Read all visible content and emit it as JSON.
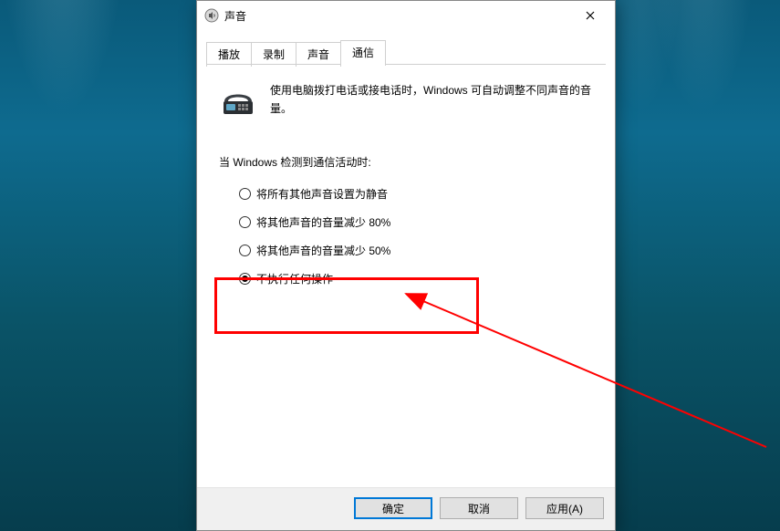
{
  "window": {
    "title": "声音"
  },
  "tabs": [
    {
      "label": "播放",
      "active": false
    },
    {
      "label": "录制",
      "active": false
    },
    {
      "label": "声音",
      "active": false
    },
    {
      "label": "通信",
      "active": true
    }
  ],
  "intro": "使用电脑拨打电话或接电话时，Windows 可自动调整不同声音的音量。",
  "subhead": "当 Windows 检测到通信活动时:",
  "options": [
    {
      "label": "将所有其他声音设置为静音",
      "checked": false
    },
    {
      "label": "将其他声音的音量减少 80%",
      "checked": false
    },
    {
      "label": "将其他声音的音量减少 50%",
      "checked": false
    },
    {
      "label": "不执行任何操作",
      "checked": true
    }
  ],
  "buttons": {
    "ok": "确定",
    "cancel": "取消",
    "apply": "应用(A)"
  },
  "annotation": {
    "color": "#ff0000"
  }
}
